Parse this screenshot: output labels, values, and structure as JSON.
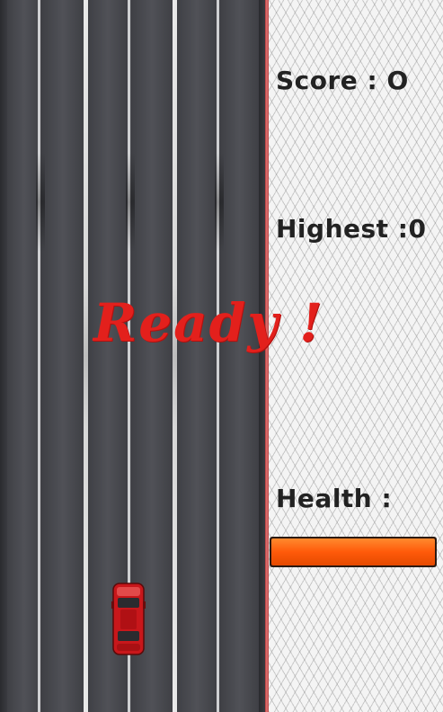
{
  "hud": {
    "score_label": "Score : O",
    "highest_label": "Highest :0",
    "health_label": "Health :"
  },
  "overlay": {
    "ready_text": "Ready !"
  },
  "health": {
    "fraction": 1.0,
    "bar_color": "#ff5a0a"
  },
  "player": {
    "car_color": "#c8171b",
    "car_icon": "red-car-icon"
  },
  "colors": {
    "road": "#45464b",
    "ready": "#e3201c",
    "divider": "#d05a5a"
  }
}
